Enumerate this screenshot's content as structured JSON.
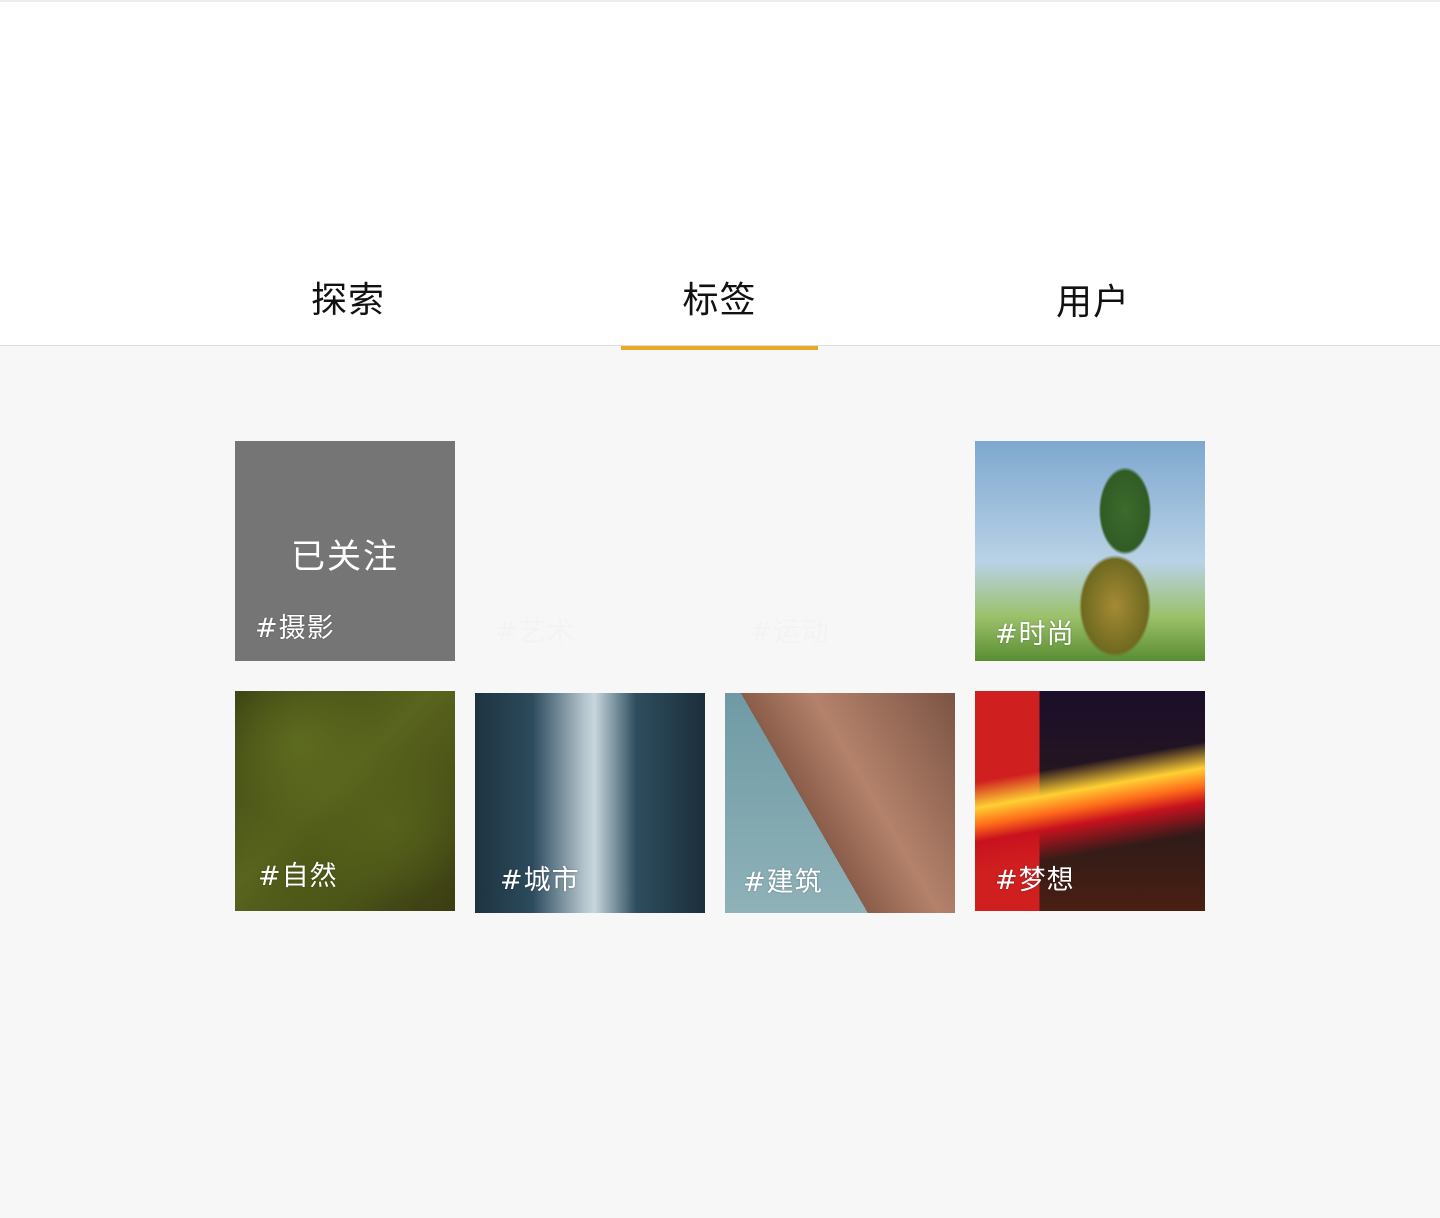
{
  "tabs": {
    "explore": "探索",
    "tags": "标签",
    "users": "用户",
    "active": "tags"
  },
  "accent_color": "#e8a92b",
  "tiles": [
    {
      "label": "#摄影",
      "overlay": "已关注",
      "image": "gray-followed-tile"
    },
    {
      "label": "#艺术",
      "image": "blank"
    },
    {
      "label": "#运动",
      "image": "blank"
    },
    {
      "label": "#时尚",
      "image": "pineapple-photo"
    },
    {
      "label": "#自然",
      "image": "forest-aerial-photo"
    },
    {
      "label": "#城市",
      "image": "city-street-photo"
    },
    {
      "label": "#建筑",
      "image": "flatiron-building-photo"
    },
    {
      "label": "#梦想",
      "image": "phone-booth-light-trails-photo"
    }
  ]
}
